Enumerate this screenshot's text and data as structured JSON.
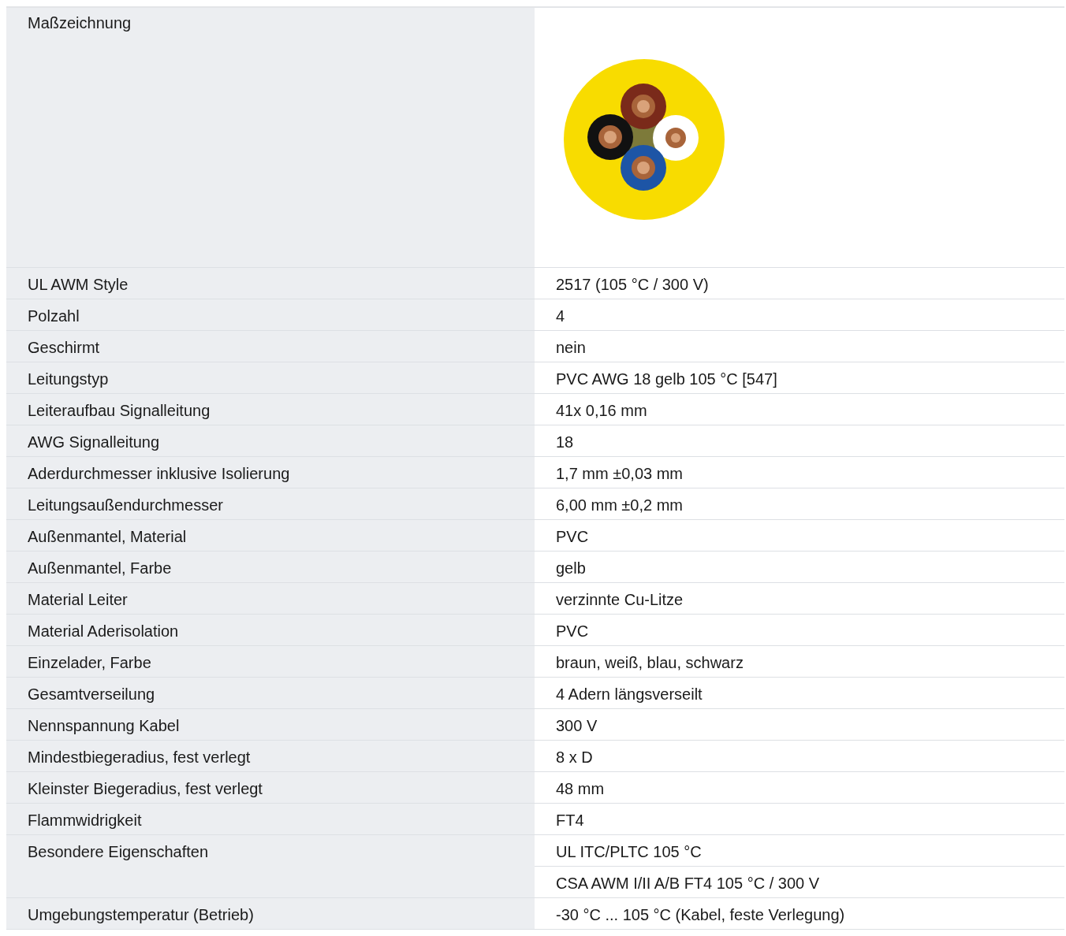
{
  "drawing_row": {
    "label": "Maßzeichnung"
  },
  "rows": [
    {
      "label": "UL AWM Style",
      "values": [
        "2517 (105 °C / 300 V)"
      ]
    },
    {
      "label": "Polzahl",
      "values": [
        "4"
      ]
    },
    {
      "label": "Geschirmt",
      "values": [
        "nein"
      ]
    },
    {
      "label": "Leitungstyp",
      "values": [
        "PVC AWG 18 gelb 105 °C [547]"
      ]
    },
    {
      "label": "Leiteraufbau Signalleitung",
      "values": [
        "41x 0,16 mm"
      ]
    },
    {
      "label": "AWG Signalleitung",
      "values": [
        "18"
      ]
    },
    {
      "label": "Aderdurchmesser inklusive Isolierung",
      "values": [
        "1,7 mm ±0,03 mm"
      ]
    },
    {
      "label": "Leitungsaußendurchmesser",
      "values": [
        "6,00 mm ±0,2 mm"
      ]
    },
    {
      "label": "Außenmantel, Material",
      "values": [
        "PVC"
      ]
    },
    {
      "label": "Außenmantel, Farbe",
      "values": [
        "gelb"
      ]
    },
    {
      "label": "Material Leiter",
      "values": [
        "verzinnte Cu-Litze"
      ]
    },
    {
      "label": "Material Aderisolation",
      "values": [
        "PVC"
      ]
    },
    {
      "label": "Einzelader, Farbe",
      "values": [
        "braun, weiß, blau, schwarz"
      ]
    },
    {
      "label": "Gesamtverseilung",
      "values": [
        "4 Adern längsverseilt"
      ]
    },
    {
      "label": "Nennspannung Kabel",
      "values": [
        "300 V"
      ]
    },
    {
      "label": "Mindestbiegeradius, fest verlegt",
      "values": [
        "8 x D"
      ]
    },
    {
      "label": "Kleinster Biegeradius, fest verlegt",
      "values": [
        "48 mm"
      ]
    },
    {
      "label": "Flammwidrigkeit",
      "values": [
        "FT4"
      ]
    },
    {
      "label": "Besondere Eigenschaften",
      "values": [
        "UL ITC/PLTC 105 °C",
        "CSA AWM I/II A/B FT4 105 °C / 300 V"
      ]
    },
    {
      "label": "Umgebungstemperatur (Betrieb)",
      "values": [
        "-30 °C ... 105 °C (Kabel, feste Verlegung)"
      ]
    }
  ]
}
